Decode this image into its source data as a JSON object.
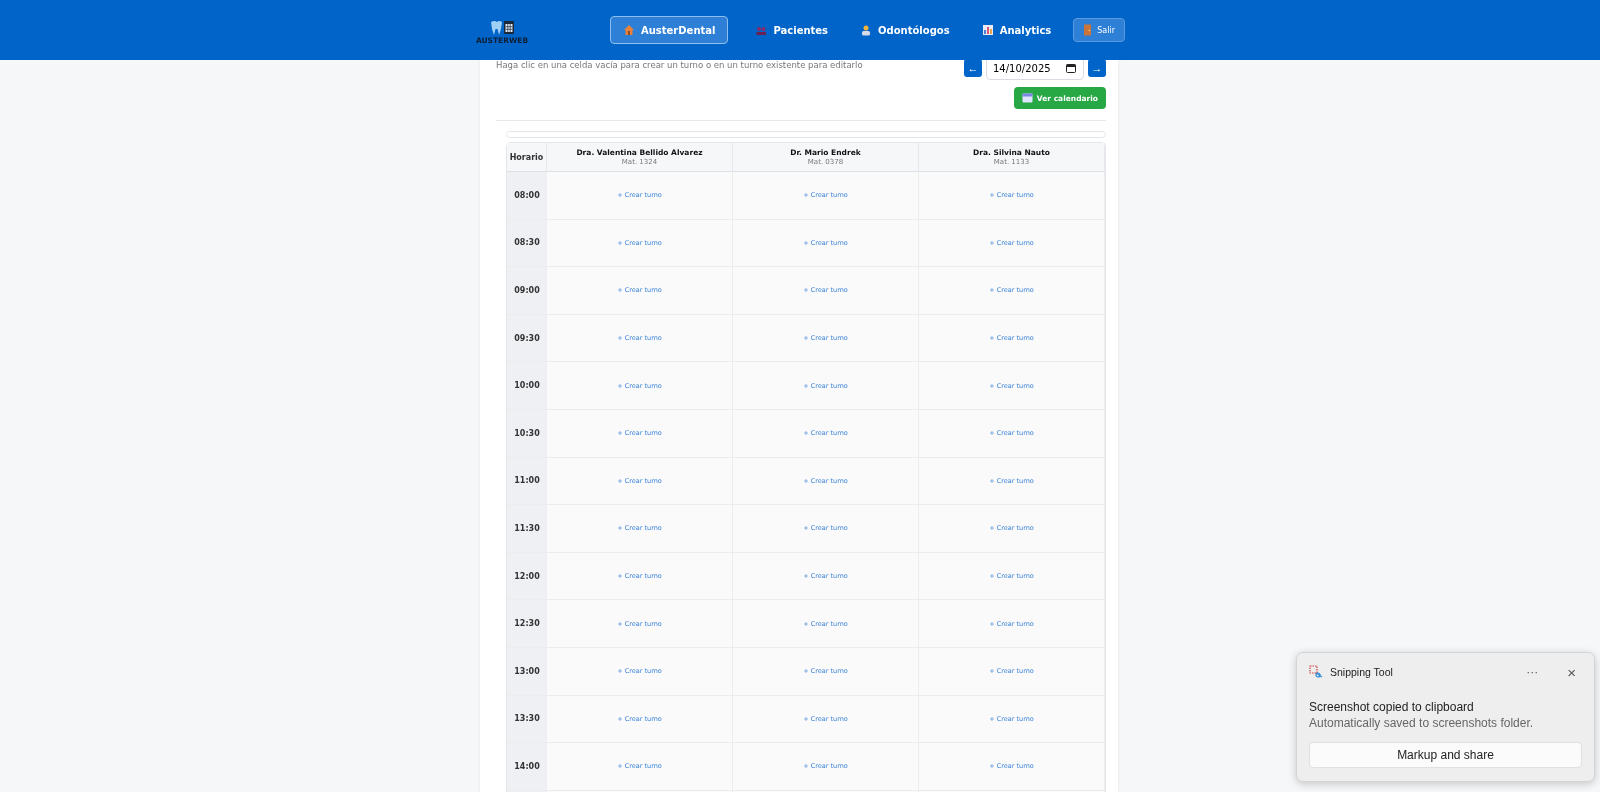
{
  "header": {
    "logo": {
      "text": "AUSTERWEB"
    },
    "nav": [
      {
        "label": "AusterDental",
        "kind": "house",
        "selected": true
      },
      {
        "label": "Pacientes",
        "kind": "people",
        "selected": false
      },
      {
        "label": "Odontólogos",
        "kind": "dentist",
        "selected": false
      },
      {
        "label": "Analytics",
        "kind": "chart",
        "selected": false
      }
    ],
    "logout": {
      "label": "Salir"
    }
  },
  "schedule": {
    "hint": "Haga clic en una celda vacía para crear un turno o en un turno existente para editarlo",
    "date_nav": {
      "prev": "←",
      "date": "14/10/2025",
      "next": "→"
    },
    "calendar_button": "Ver calendario",
    "time_header": "Horario",
    "dentists": [
      {
        "name": "Dra. Valentina Bellido Alvarez",
        "license": "Mat. 1324"
      },
      {
        "name": "Dr. Mario Endrek",
        "license": "Mat. 0378"
      },
      {
        "name": "Dra. Silvina Nauto",
        "license": "Mat. 1133"
      }
    ],
    "rows": [
      {
        "time": "08:00",
        "cells": [
          "+ Crear turno",
          "+ Crear turno",
          "+ Crear turno"
        ]
      },
      {
        "time": "08:30",
        "cells": [
          "+ Crear turno",
          "+ Crear turno",
          "+ Crear turno"
        ]
      },
      {
        "time": "09:00",
        "cells": [
          "+ Crear turno",
          "+ Crear turno",
          "+ Crear turno"
        ]
      },
      {
        "time": "09:30",
        "cells": [
          "+ Crear turno",
          "+ Crear turno",
          "+ Crear turno"
        ]
      },
      {
        "time": "10:00",
        "cells": [
          "+ Crear turno",
          "+ Crear turno",
          "+ Crear turno"
        ]
      },
      {
        "time": "10:30",
        "cells": [
          "+ Crear turno",
          "+ Crear turno",
          "+ Crear turno"
        ]
      },
      {
        "time": "11:00",
        "cells": [
          "+ Crear turno",
          "+ Crear turno",
          "+ Crear turno"
        ]
      },
      {
        "time": "11:30",
        "cells": [
          "+ Crear turno",
          "+ Crear turno",
          "+ Crear turno"
        ]
      },
      {
        "time": "12:00",
        "cells": [
          "+ Crear turno",
          "+ Crear turno",
          "+ Crear turno"
        ]
      },
      {
        "time": "12:30",
        "cells": [
          "+ Crear turno",
          "+ Crear turno",
          "+ Crear turno"
        ]
      },
      {
        "time": "13:00",
        "cells": [
          "+ Crear turno",
          "+ Crear turno",
          "+ Crear turno"
        ]
      },
      {
        "time": "13:30",
        "cells": [
          "+ Crear turno",
          "+ Crear turno",
          "+ Crear turno"
        ]
      },
      {
        "time": "14:00",
        "cells": [
          "+ Crear turno",
          "+ Crear turno",
          "+ Crear turno"
        ]
      }
    ]
  },
  "notification": {
    "app": "Snipping Tool",
    "more": "···",
    "close": "×",
    "title": "Screenshot copied to clipboard",
    "message": "Automatically saved to screenshots folder.",
    "action": "Markup and share"
  }
}
